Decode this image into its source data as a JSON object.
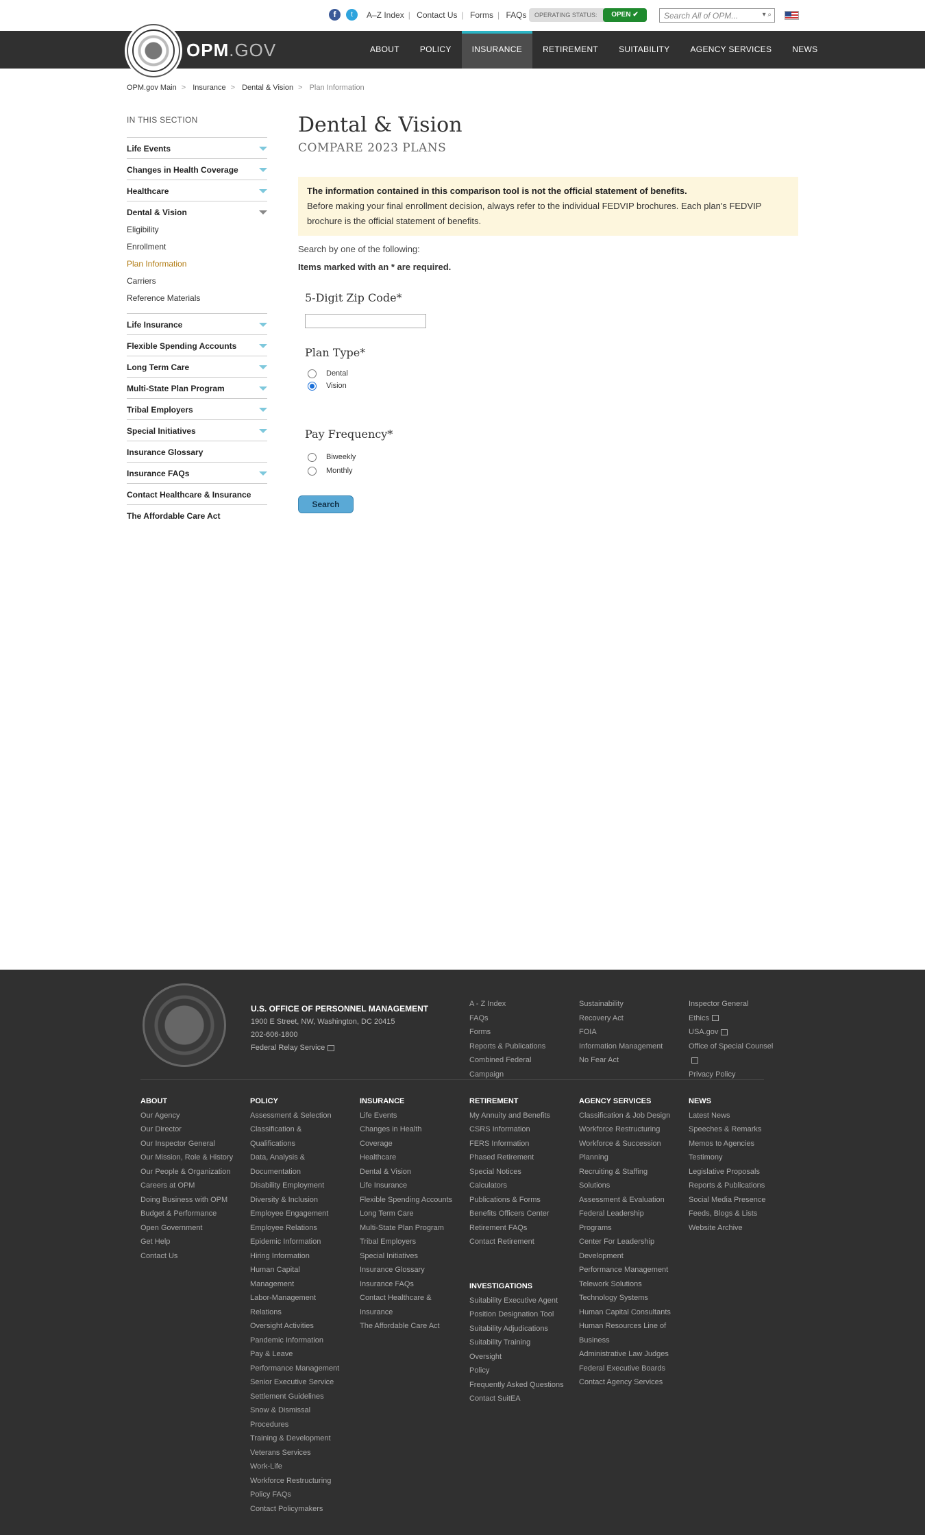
{
  "utility": {
    "links": [
      "A–Z Index",
      "Contact Us",
      "Forms",
      "FAQs"
    ],
    "operating_status_label": "OPERATING STATUS:",
    "operating_status_value": "OPEN",
    "search_placeholder": "Search All of OPM..."
  },
  "header": {
    "logo_main": "OPM",
    "logo_suffix": ".GOV",
    "nav": [
      "ABOUT",
      "POLICY",
      "INSURANCE",
      "RETIREMENT",
      "SUITABILITY",
      "AGENCY SERVICES",
      "NEWS"
    ],
    "active_nav": "INSURANCE"
  },
  "breadcrumb": [
    "OPM.gov Main",
    "Insurance",
    "Dental & Vision",
    "Plan Information"
  ],
  "sidebar": {
    "title": "IN THIS SECTION",
    "items_before": [
      "Life Events",
      "Changes in Health Coverage",
      "Healthcare"
    ],
    "open_item": "Dental & Vision",
    "subitems": [
      "Eligibility",
      "Enrollment",
      "Plan Information",
      "Carriers",
      "Reference Materials"
    ],
    "current_subitem": "Plan Information",
    "items_after": [
      {
        "label": "Life Insurance",
        "arrow": true
      },
      {
        "label": "Flexible Spending Accounts",
        "arrow": true
      },
      {
        "label": "Long Term Care",
        "arrow": true
      },
      {
        "label": "Multi-State Plan Program",
        "arrow": true
      },
      {
        "label": "Tribal Employers",
        "arrow": true
      },
      {
        "label": "Special Initiatives",
        "arrow": true
      },
      {
        "label": "Insurance Glossary",
        "arrow": false
      },
      {
        "label": "Insurance FAQs",
        "arrow": true
      },
      {
        "label": "Contact Healthcare & Insurance",
        "arrow": false
      },
      {
        "label": "The Affordable Care Act",
        "arrow": false
      }
    ]
  },
  "main": {
    "title": "Dental & Vision",
    "subtitle": "COMPARE 2023 PLANS",
    "notice_bold": "The information contained in this comparison tool is not the official statement of benefits.",
    "notice_text": "Before making your final enrollment decision, always refer to the individual FEDVIP brochures. Each plan's FEDVIP brochure is the official statement of benefits.",
    "search_by": "Search by one of the following:",
    "required_note": "Items marked with an * are required.",
    "zip_label": "5-Digit Zip Code*",
    "zip_value": "",
    "plan_type_label": "Plan Type*",
    "plan_type_options": [
      "Dental",
      "Vision"
    ],
    "plan_type_selected": "Vision",
    "pay_frequency_label": "Pay Frequency*",
    "pay_frequency_options": [
      "Biweekly",
      "Monthly"
    ],
    "search_button": "Search"
  },
  "footer": {
    "org": "U.S. OFFICE OF PERSONNEL MANAGEMENT",
    "address": "1900 E Street, NW, Washington, DC 20415",
    "phone": "202-606-1800",
    "relay": "Federal Relay Service",
    "top_col1": [
      "A - Z Index",
      "FAQs",
      "Forms",
      "Reports & Publications",
      "Combined Federal",
      "Campaign"
    ],
    "top_col2": [
      "Sustainability",
      "Recovery Act",
      "FOIA",
      "Information Management",
      "No Fear Act"
    ],
    "top_col3": [
      "Inspector General",
      "Ethics",
      "USA.gov",
      "Office of Special Counsel",
      "",
      "Privacy Policy"
    ],
    "about": {
      "title": "ABOUT",
      "items": [
        "Our Agency",
        "Our Director",
        "Our Inspector General",
        "Our Mission, Role & History",
        "Our People & Organization",
        "Careers at OPM",
        "Doing Business with OPM",
        "Budget & Performance",
        "Open Government",
        "Get Help",
        "Contact Us"
      ]
    },
    "policy": {
      "title": "POLICY",
      "items": [
        "Assessment & Selection",
        "Classification &",
        "Qualifications",
        "Data, Analysis &",
        "Documentation",
        "Disability Employment",
        "Diversity & Inclusion",
        "Employee Engagement",
        "Employee Relations",
        "Epidemic Information",
        "Hiring Information",
        "Human Capital",
        "Management",
        "Labor-Management",
        "Relations",
        "Oversight Activities",
        "Pandemic Information",
        "Pay & Leave",
        "Performance Management",
        "Senior Executive Service",
        "Settlement Guidelines",
        "Snow & Dismissal",
        "Procedures",
        "Training & Development",
        "Veterans Services",
        "Work-Life",
        "Workforce Restructuring",
        "Policy FAQs",
        "Contact Policymakers"
      ]
    },
    "insurance": {
      "title": "INSURANCE",
      "items": [
        "Life Events",
        "Changes in Health",
        "Coverage",
        "Healthcare",
        "Dental & Vision",
        "Life Insurance",
        "Flexible Spending Accounts",
        "Long Term Care",
        "Multi-State Plan Program",
        "Tribal Employers",
        "Special Initiatives",
        "Insurance Glossary",
        "Insurance FAQs",
        "Contact Healthcare &",
        "Insurance",
        "The Affordable Care Act"
      ]
    },
    "retirement": {
      "title": "RETIREMENT",
      "items": [
        "My Annuity and Benefits",
        "CSRS Information",
        "FERS Information",
        "Phased Retirement",
        "Special Notices",
        "Calculators",
        "Publications & Forms",
        "Benefits Officers Center",
        "Retirement FAQs",
        "Contact Retirement"
      ]
    },
    "investigations": {
      "title": "INVESTIGATIONS",
      "items": [
        "Suitability Executive Agent",
        "Position Designation Tool",
        "Suitability Adjudications",
        "Suitability Training",
        "Oversight",
        "Policy",
        "Frequently Asked Questions",
        "Contact SuitEA"
      ]
    },
    "agency": {
      "title": "AGENCY SERVICES",
      "items": [
        "Classification & Job Design",
        "Workforce Restructuring",
        "Workforce & Succession",
        "Planning",
        "Recruiting & Staffing",
        "Solutions",
        "Assessment & Evaluation",
        "Federal Leadership",
        "Programs",
        "Center For Leadership",
        "Development",
        "Performance Management",
        "Telework Solutions",
        "Technology Systems",
        "Human Capital Consultants",
        "Human Resources Line of",
        "Business",
        "Administrative Law Judges",
        "Federal Executive Boards",
        "Contact Agency Services"
      ]
    },
    "news": {
      "title": "NEWS",
      "items": [
        "Latest News",
        "Speeches & Remarks",
        "Memos to Agencies",
        "Testimony",
        "Legislative Proposals",
        "Reports & Publications",
        "Social Media Presence",
        "Feeds, Blogs & Lists",
        "Website Archive"
      ]
    }
  }
}
